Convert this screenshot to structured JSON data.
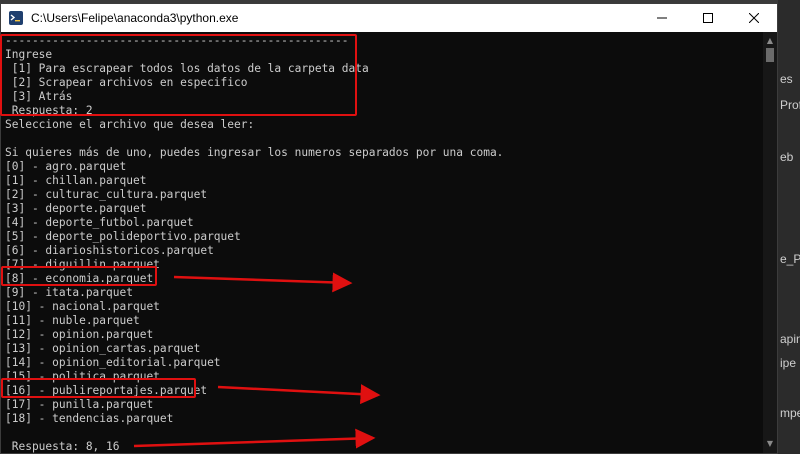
{
  "window": {
    "title": "C:\\Users\\Felipe\\anaconda3\\python.exe",
    "controls": [
      "minimize",
      "maximize",
      "close"
    ]
  },
  "console": {
    "lines": [
      "---------------------------------------------------",
      "Ingrese",
      " [1] Para escrapear todos los datos de la carpeta data",
      " [2] Scrapear archivos en especifico",
      " [3] Atrás",
      " Respuesta: 2",
      "Seleccione el archivo que desea leer:",
      "",
      "Si quieres más de uno, puedes ingresar los numeros separados por una coma.",
      "[0] - agro.parquet",
      "[1] - chillan.parquet",
      "[2] - culturac_cultura.parquet",
      "[3] - deporte.parquet",
      "[4] - deporte_futbol.parquet",
      "[5] - deporte_polideportivo.parquet",
      "[6] - diarioshistoricos.parquet",
      "[7] - diguillin.parquet",
      "[8] - economia.parquet",
      "[9] - itata.parquet",
      "[10] - nacional.parquet",
      "[11] - nuble.parquet",
      "[12] - opinion.parquet",
      "[13] - opinion_cartas.parquet",
      "[14] - opinion_editorial.parquet",
      "[15] - politica.parquet",
      "[16] - publireportajes.parquet",
      "[17] - punilla.parquet",
      "[18] - tendencias.parquet",
      "",
      " Respuesta: 8, 16"
    ]
  },
  "background_fragments": [
    "es",
    "Prof",
    "eb",
    "e_Pro",
    "apin",
    "ipe",
    "mpe"
  ],
  "colors": {
    "console_bg": "#0c0c0c",
    "console_text": "#cccccc",
    "annotation": "#e01010",
    "titlebar_bg": "#ffffff"
  }
}
